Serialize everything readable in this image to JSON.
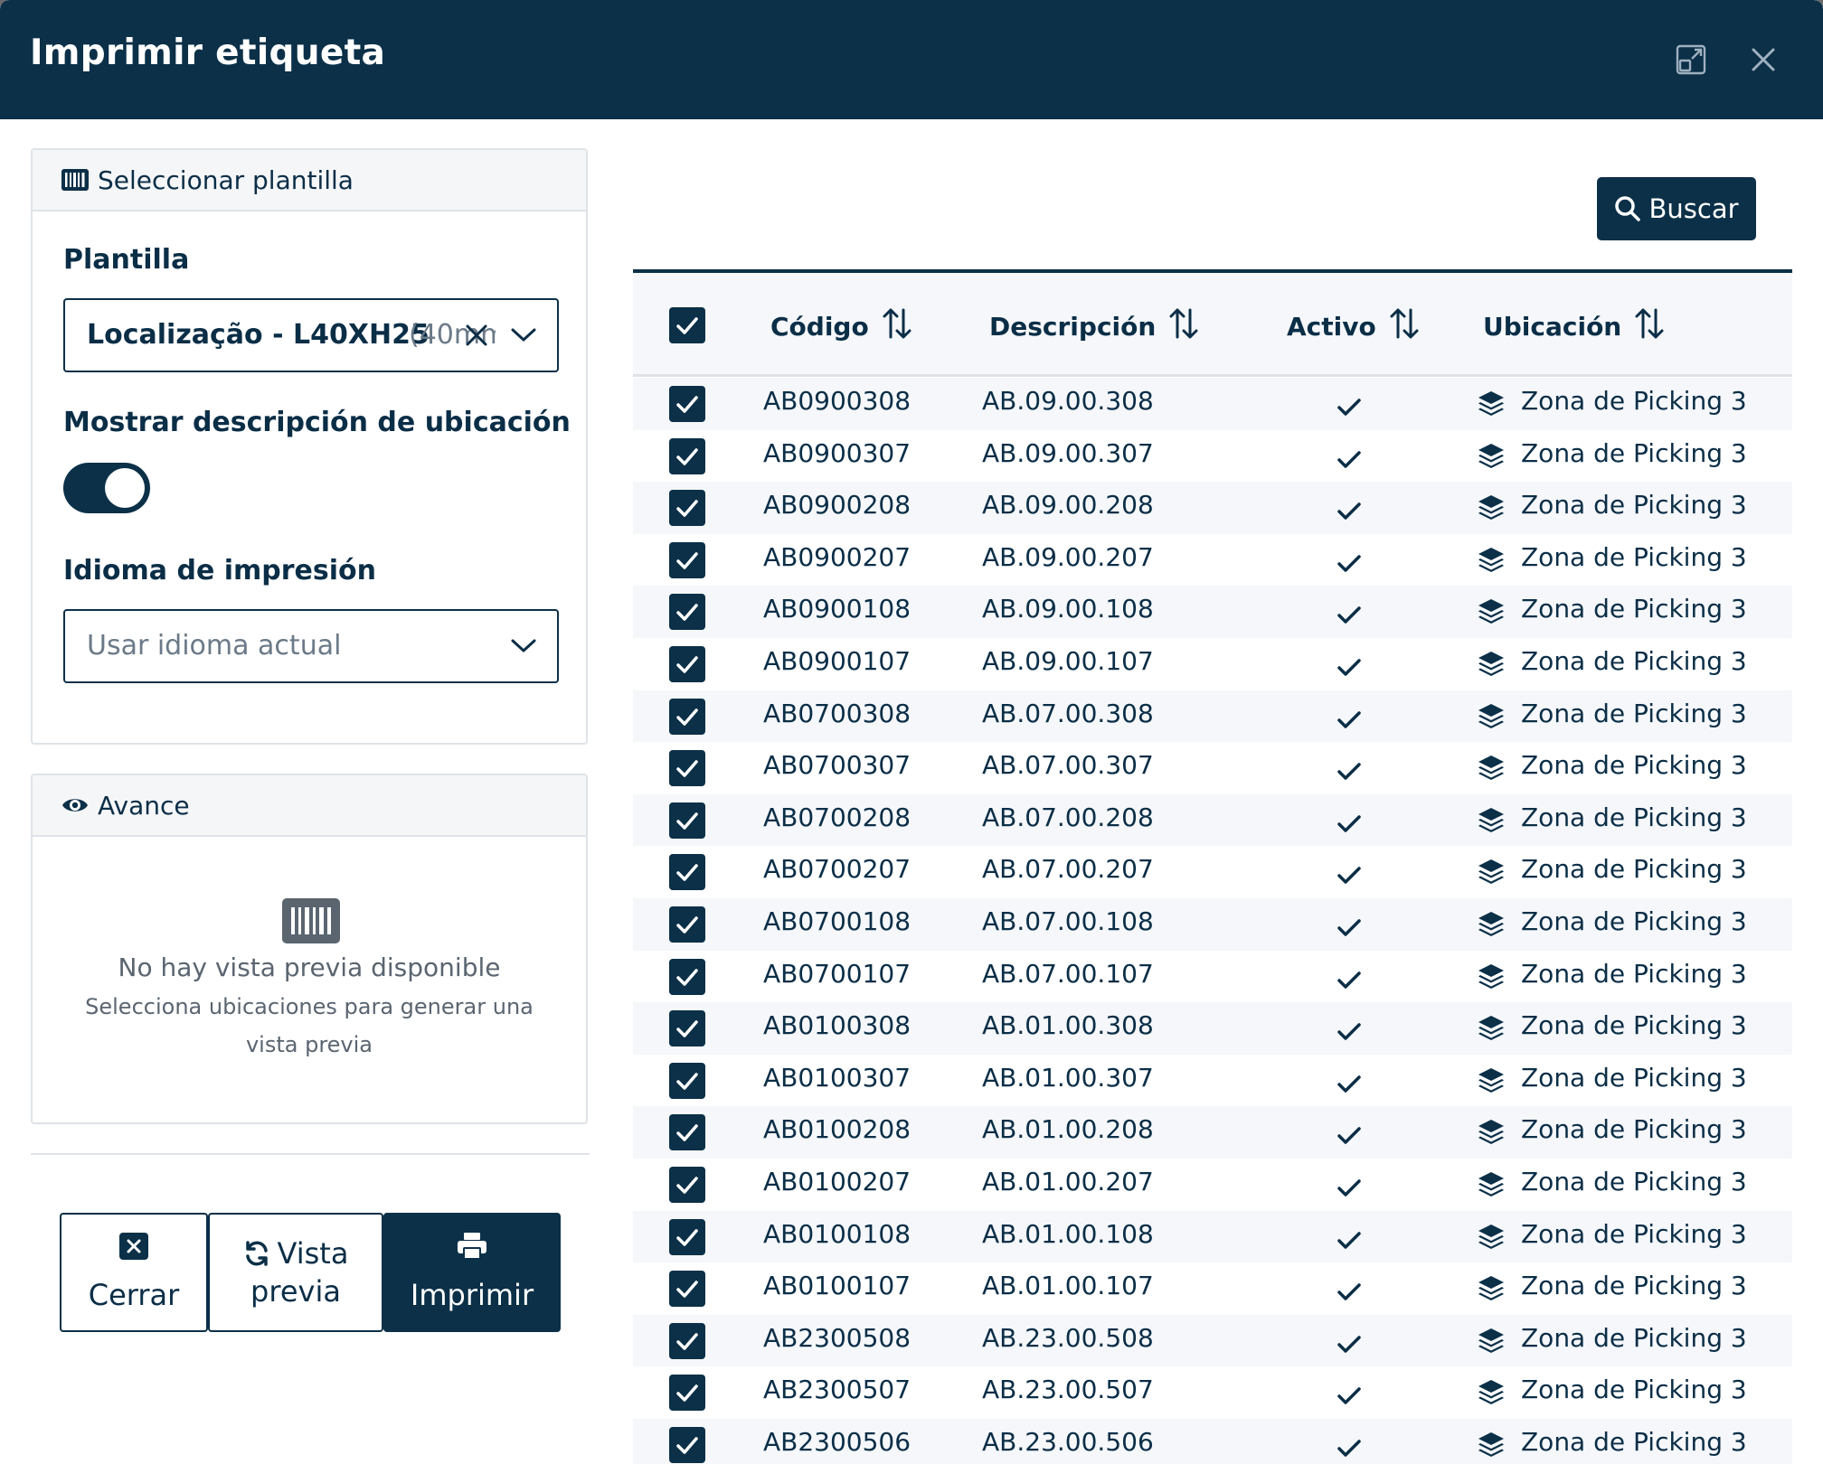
{
  "dialog": {
    "title": "Imprimir etiqueta"
  },
  "template_panel": {
    "title": "Seleccionar plantilla",
    "template_label": "Plantilla",
    "template_value": "Localização - L40XH25",
    "template_value_suffix": "(40mm",
    "show_description_label": "Mostrar descripción de ubicación",
    "show_description_on": true,
    "language_label": "Idioma de impresión",
    "language_placeholder": "Usar idioma actual"
  },
  "preview_panel": {
    "title": "Avance",
    "empty_title": "No hay vista previa disponible",
    "empty_line1": "Selecciona ubicaciones para generar una",
    "empty_line2": "vista previa"
  },
  "actions": {
    "close_label": "Cerrar",
    "preview_line1": "Vista",
    "preview_line2": "previa",
    "print_label": "Imprimir"
  },
  "search_button_label": "Buscar",
  "table": {
    "headers": {
      "code": "Código",
      "description": "Descripción",
      "active": "Activo",
      "location": "Ubicación"
    },
    "rows": [
      {
        "code": "AB0900308",
        "description": "AB.09.00.308",
        "location": "Zona de Picking 3"
      },
      {
        "code": "AB0900307",
        "description": "AB.09.00.307",
        "location": "Zona de Picking 3"
      },
      {
        "code": "AB0900208",
        "description": "AB.09.00.208",
        "location": "Zona de Picking 3"
      },
      {
        "code": "AB0900207",
        "description": "AB.09.00.207",
        "location": "Zona de Picking 3"
      },
      {
        "code": "AB0900108",
        "description": "AB.09.00.108",
        "location": "Zona de Picking 3"
      },
      {
        "code": "AB0900107",
        "description": "AB.09.00.107",
        "location": "Zona de Picking 3"
      },
      {
        "code": "AB0700308",
        "description": "AB.07.00.308",
        "location": "Zona de Picking 3"
      },
      {
        "code": "AB0700307",
        "description": "AB.07.00.307",
        "location": "Zona de Picking 3"
      },
      {
        "code": "AB0700208",
        "description": "AB.07.00.208",
        "location": "Zona de Picking 3"
      },
      {
        "code": "AB0700207",
        "description": "AB.07.00.207",
        "location": "Zona de Picking 3"
      },
      {
        "code": "AB0700108",
        "description": "AB.07.00.108",
        "location": "Zona de Picking 3"
      },
      {
        "code": "AB0700107",
        "description": "AB.07.00.107",
        "location": "Zona de Picking 3"
      },
      {
        "code": "AB0100308",
        "description": "AB.01.00.308",
        "location": "Zona de Picking 3"
      },
      {
        "code": "AB0100307",
        "description": "AB.01.00.307",
        "location": "Zona de Picking 3"
      },
      {
        "code": "AB0100208",
        "description": "AB.01.00.208",
        "location": "Zona de Picking 3"
      },
      {
        "code": "AB0100207",
        "description": "AB.01.00.207",
        "location": "Zona de Picking 3"
      },
      {
        "code": "AB0100108",
        "description": "AB.01.00.108",
        "location": "Zona de Picking 3"
      },
      {
        "code": "AB0100107",
        "description": "AB.01.00.107",
        "location": "Zona de Picking 3"
      },
      {
        "code": "AB2300508",
        "description": "AB.23.00.508",
        "location": "Zona de Picking 3"
      },
      {
        "code": "AB2300507",
        "description": "AB.23.00.507",
        "location": "Zona de Picking 3"
      },
      {
        "code": "AB2300506",
        "description": "AB.23.00.506",
        "location": "Zona de Picking 3"
      }
    ]
  },
  "colors": {
    "primary": "#0b3048",
    "row_alt": "#f5f7fa",
    "border": "#dfe3e8"
  },
  "icons": {
    "header": [
      "expand-icon",
      "close-icon"
    ],
    "template_panel": "barcode-icon",
    "preview_panel": "eye-icon",
    "location": "layers-icon",
    "active": "check-icon",
    "search": "search-icon",
    "sort": "sort-icon"
  }
}
